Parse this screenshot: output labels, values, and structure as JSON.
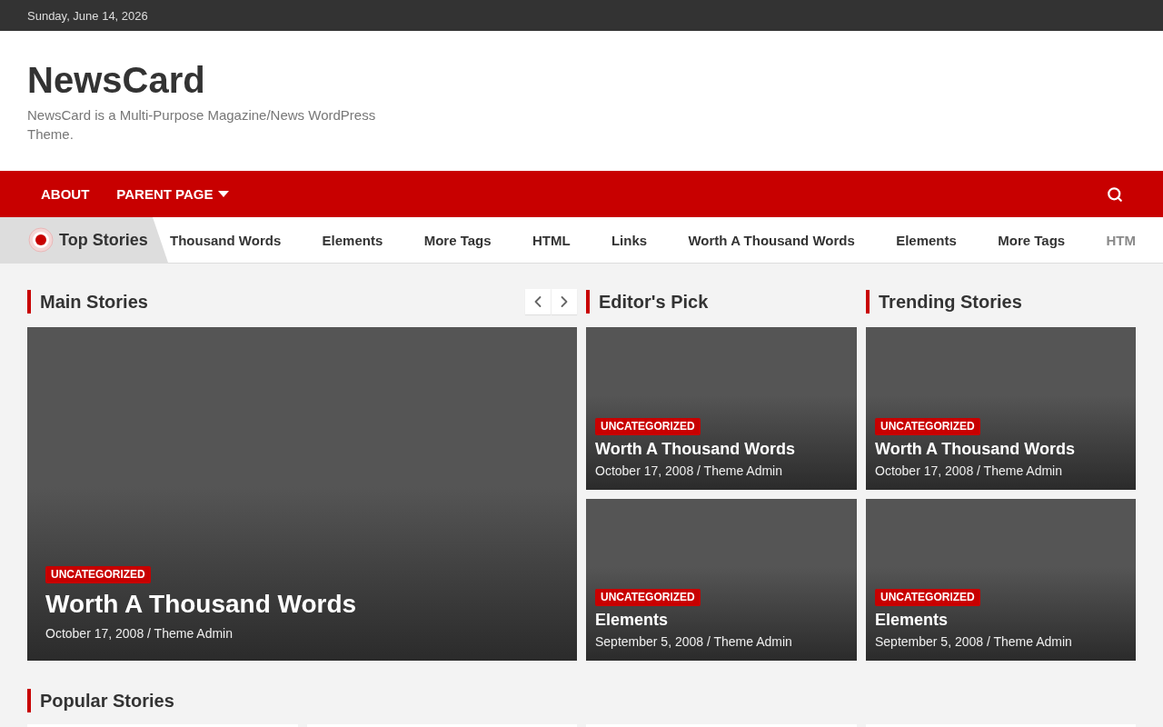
{
  "top_bar": {
    "date": "Sunday, June 14, 2026"
  },
  "header": {
    "site_title": "NewsCard",
    "tagline": "NewsCard is a Multi-Purpose Magazine/News WordPress Theme."
  },
  "nav": {
    "items": [
      {
        "label": "ABOUT",
        "has_submenu": false
      },
      {
        "label": "PARENT PAGE",
        "has_submenu": true
      }
    ]
  },
  "ticker": {
    "label": "Top Stories",
    "items": [
      {
        "text": "Thousand Words",
        "faded": false
      },
      {
        "text": "Elements",
        "faded": false
      },
      {
        "text": "More Tags",
        "faded": false
      },
      {
        "text": "HTML",
        "faded": false
      },
      {
        "text": "Links",
        "faded": false
      },
      {
        "text": "Worth A Thousand Words",
        "faded": false
      },
      {
        "text": "Elements",
        "faded": false
      },
      {
        "text": "More Tags",
        "faded": false
      },
      {
        "text": "HTM",
        "faded": true
      }
    ]
  },
  "sections": [
    {
      "title": "Main Stories",
      "kind": "featured",
      "carousel_arrows": true,
      "posts": [
        {
          "category": "UNCATEGORIZED",
          "title": "Worth A Thousand Words",
          "meta": "October 17, 2008 / Theme Admin"
        }
      ]
    },
    {
      "title": "Editor's Pick",
      "kind": "stack",
      "carousel_arrows": false,
      "posts": [
        {
          "category": "UNCATEGORIZED",
          "title": "Worth A Thousand Words",
          "meta": "October 17, 2008 / Theme Admin"
        },
        {
          "category": "UNCATEGORIZED",
          "title": "Elements",
          "meta": "September 5, 2008 / Theme Admin"
        }
      ]
    },
    {
      "title": "Trending Stories",
      "kind": "stack",
      "carousel_arrows": false,
      "posts": [
        {
          "category": "UNCATEGORIZED",
          "title": "Worth A Thousand Words",
          "meta": "October 17, 2008 / Theme Admin"
        },
        {
          "category": "UNCATEGORIZED",
          "title": "Elements",
          "meta": "September 5, 2008 / Theme Admin"
        }
      ]
    }
  ],
  "popular": {
    "title": "Popular Stories"
  }
}
